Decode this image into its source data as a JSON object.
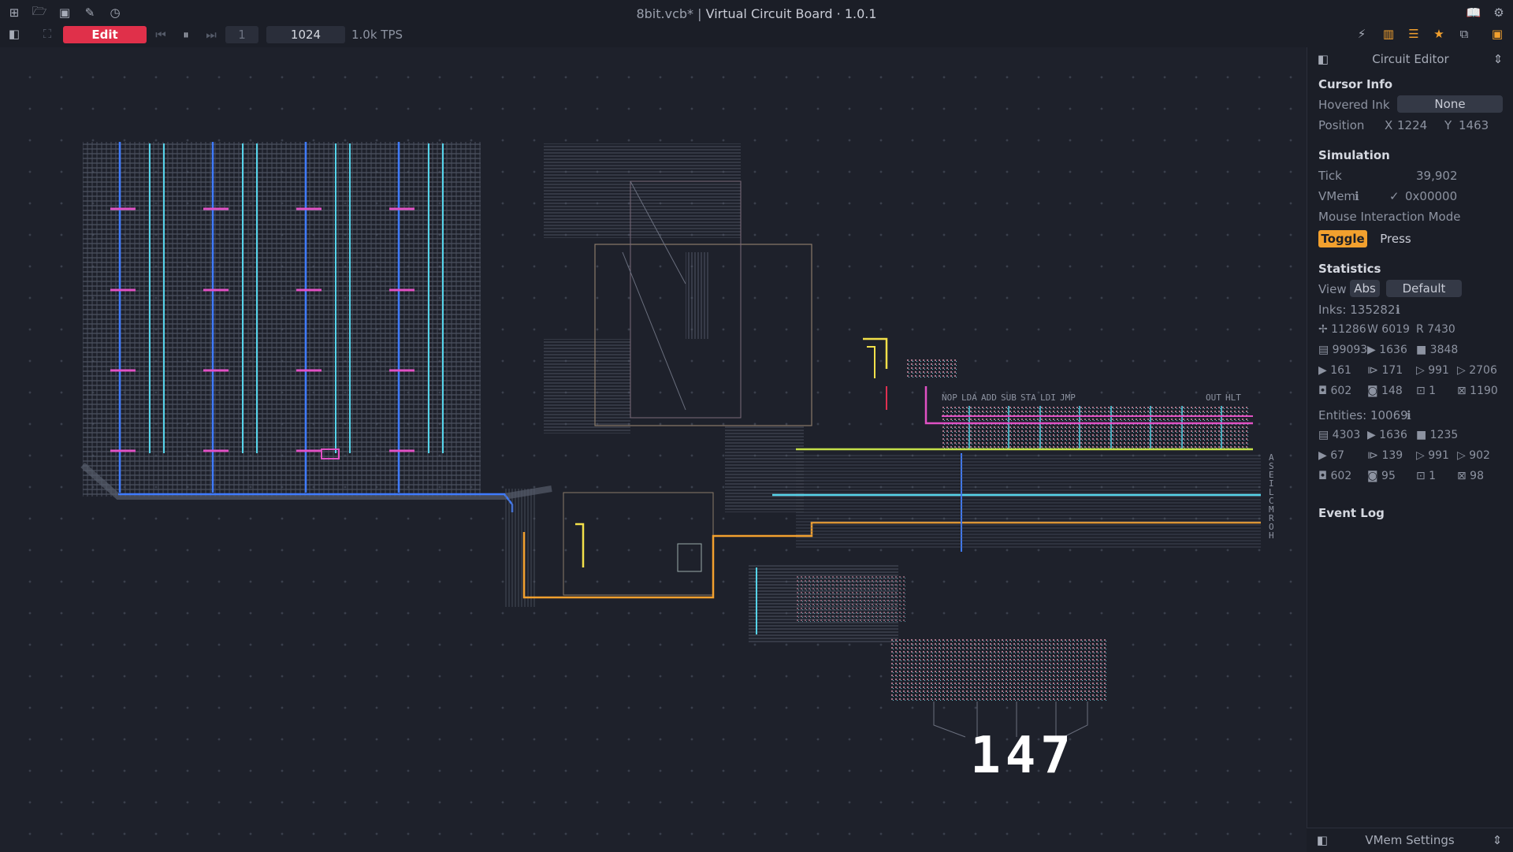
{
  "window": {
    "file": "8bit.vcb*",
    "separator": "|",
    "app": "Virtual Circuit Board · 1.0.1"
  },
  "toolbar": {
    "edit_label": "Edit",
    "step_count": "1",
    "tick_rate": "1024",
    "tps": "1.0k TPS"
  },
  "canvas": {
    "display_value": "147",
    "instructions": [
      "NOP",
      "LDA",
      "ADD",
      "SUB",
      "STA",
      "LDI",
      "JMP",
      "OUT",
      "HLT"
    ],
    "bus_labels": [
      "A",
      "S",
      "E",
      "I",
      "L",
      "C",
      "M",
      "R",
      "O",
      "H"
    ]
  },
  "panel": {
    "title": "Circuit Editor",
    "cursor_info": {
      "heading": "Cursor Info",
      "hovered_label": "Hovered Ink",
      "hovered_value": "None",
      "position_label": "Position",
      "x_label": "X",
      "x_value": "1224",
      "y_label": "Y",
      "y_value": "1463"
    },
    "simulation": {
      "heading": "Simulation",
      "tick_label": "Tick",
      "tick_value": "39,902",
      "vmem_label": "VMem",
      "vmem_value": "0x00000",
      "mode_label": "Mouse Interaction Mode",
      "toggle": "Toggle",
      "press": "Press"
    },
    "statistics": {
      "heading": "Statistics",
      "view_label": "View",
      "abs": "Abs",
      "default": "Default",
      "inks_label": "Inks: 135282",
      "inks": [
        [
          "✢ 11286",
          "W 6019",
          "R 7430"
        ],
        [
          "▤ 99093",
          "▶ 1636",
          "■ 3848"
        ],
        [
          "▶ 161",
          "⧐ 171",
          "▷ 991",
          "▷ 2706"
        ],
        [
          "◘ 602",
          "◙ 148",
          "⊡ 1",
          "⊠ 1190"
        ]
      ],
      "entities_label": "Entities: 10069",
      "entities": [
        [
          "▤ 4303",
          "▶ 1636",
          "■ 1235"
        ],
        [
          "▶ 67",
          "⧐ 139",
          "▷ 991",
          "▷ 902"
        ],
        [
          "◘ 602",
          "◙ 95",
          "⊡ 1",
          "⊠ 98"
        ]
      ]
    },
    "event_log": "Event Log",
    "footer": "VMem Settings"
  }
}
